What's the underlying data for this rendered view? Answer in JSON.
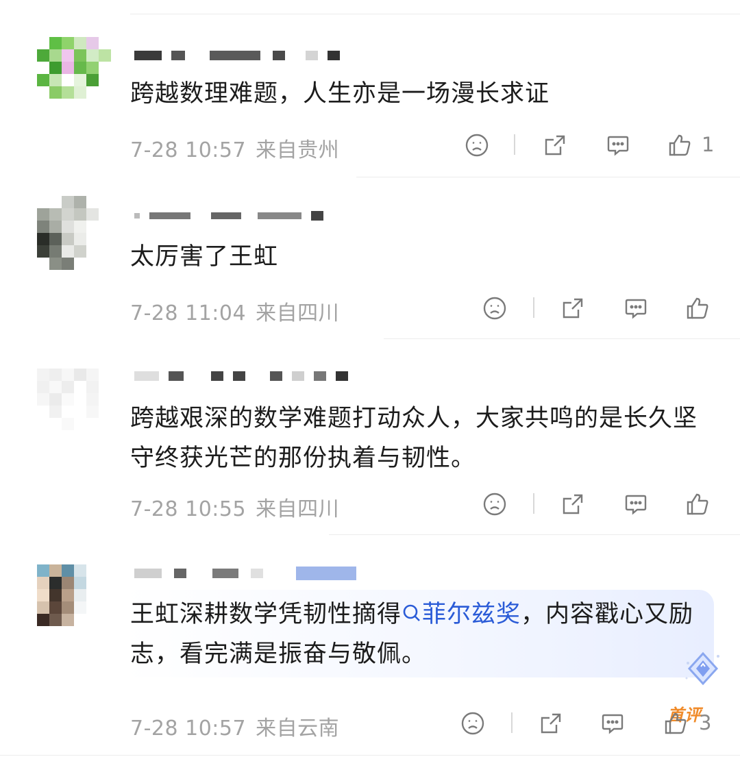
{
  "comments": [
    {
      "text": "跨越数理难题，人生亦是一场漫长求证",
      "time": "7-28 10:57",
      "location": "来自贵州",
      "likes": "1",
      "avatar_colors": [
        "#ffffff",
        "#5fbf45",
        "#8fd36b",
        "#cfe8c0",
        "#e6c9e8",
        "#ffffff",
        "#4da93a",
        "#a8d98e",
        "#f0c6ee",
        "#7cc45a",
        "#d2ecc6",
        "#bde3a4",
        "#ffffff",
        "#3e9c2f",
        "#e9b6e4",
        "#66b94b",
        "#92d172",
        "#ffffff",
        "#5bb542",
        "#c7e6b4",
        "#ffffff",
        "#e5f4dc",
        "#4a9f36",
        "#ffffff",
        "#ffffff",
        "#8acb66",
        "#b4df98",
        "#dff0d4",
        "#ffffff",
        "#ffffff",
        "#ffffff",
        "#ffffff",
        "#ffffff",
        "#ffffff",
        "#ffffff",
        "#ffffff"
      ]
    },
    {
      "text": "太厉害了王虹",
      "time": "7-28 11:04",
      "location": "来自四川",
      "likes": "",
      "avatar_colors": [
        "#ffffff",
        "#ffffff",
        "#c9ccc7",
        "#aeb2ab",
        "#ffffff",
        "#ffffff",
        "#9ea39a",
        "#b8bcb4",
        "#d2d4cf",
        "#c4c7c0",
        "#e4e5e2",
        "#ffffff",
        "#7e837b",
        "#a9ada5",
        "#dfe0dd",
        "#f0f1ee",
        "#ffffff",
        "#ffffff",
        "#2a2d28",
        "#5c615a",
        "#c8cac4",
        "#ebece9",
        "#ffffff",
        "#ffffff",
        "#3b3f38",
        "#767b73",
        "#e9eae7",
        "#d0d2cc",
        "#ffffff",
        "#ffffff",
        "#ffffff",
        "#8a8f86",
        "#7a7e77",
        "#ffffff",
        "#ffffff",
        "#ffffff"
      ]
    },
    {
      "text": "跨越艰深的数学难题打动众人，大家共鸣的是长久坚守终获光芒的那份执着与韧性。",
      "time": "7-28 10:55",
      "location": "来自四川",
      "likes": "",
      "badge": "首评",
      "avatar_colors": [
        "#f3f3f3",
        "#eeeeee",
        "#f7f7f7",
        "#e9e9e9",
        "#f5f5f5",
        "#ffffff",
        "#f0f0f0",
        "#f8f8f8",
        "#ededed",
        "#ffffff",
        "#f2f2f2",
        "#ffffff",
        "#f6f6f6",
        "#ebebeb",
        "#fafafa",
        "#ffffff",
        "#f4f4f4",
        "#ffffff",
        "#ffffff",
        "#f1f1f1",
        "#ffffff",
        "#ffffff",
        "#f7f7f7",
        "#ffffff",
        "#ffffff",
        "#ffffff",
        "#f9f9f9",
        "#ffffff",
        "#ffffff",
        "#ffffff",
        "#ffffff",
        "#ffffff",
        "#ffffff",
        "#ffffff",
        "#ffffff",
        "#ffffff"
      ]
    },
    {
      "text_before": "王虹深耕数学凭韧性摘得",
      "link_text": "菲尔兹奖",
      "text_after": "，内容戳心又励志，看完满是振奋与敬佩。",
      "time": "7-28 10:57",
      "location": "来自云南",
      "likes": "3",
      "avatar_colors": [
        "#7fb3c9",
        "#c9b39a",
        "#5f8fa6",
        "#d7e4ea",
        "#ffffff",
        "#ffffff",
        "#e5d1bd",
        "#2b2d2c",
        "#9b8674",
        "#c4d8e1",
        "#ffffff",
        "#ffffff",
        "#f0ddc9",
        "#43352c",
        "#b9a08a",
        "#e9eef0",
        "#ffffff",
        "#ffffff",
        "#d6c2ad",
        "#5b463a",
        "#a48d79",
        "#f4f6f7",
        "#ffffff",
        "#ffffff",
        "#3a2a24",
        "#6e5a4d",
        "#c7b3a0",
        "#ffffff",
        "#ffffff",
        "#ffffff",
        "#ffffff",
        "#ffffff",
        "#ffffff",
        "#ffffff",
        "#ffffff",
        "#ffffff"
      ]
    }
  ]
}
